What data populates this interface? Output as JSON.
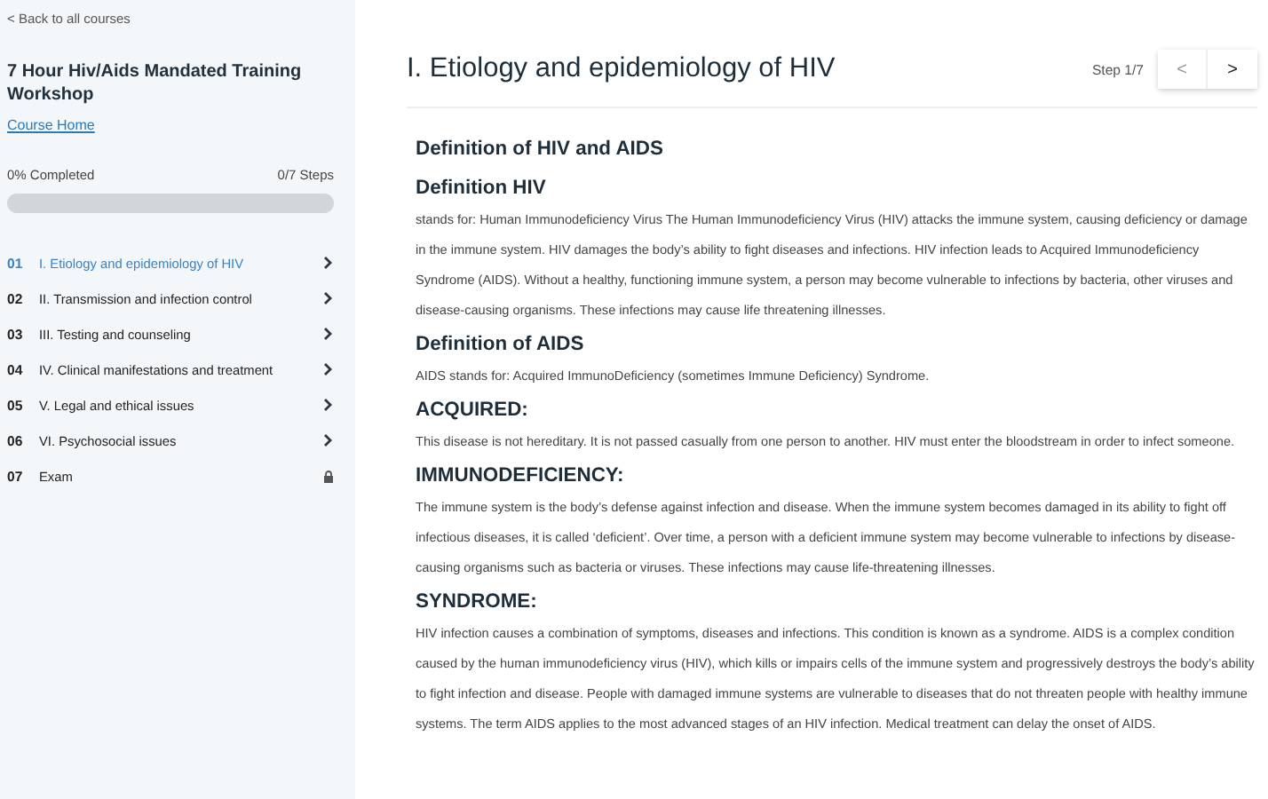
{
  "sidebar": {
    "back_link": "< Back to all courses",
    "course_title": "7 Hour Hiv/Aids Mandated Training Workshop",
    "course_home": "Course Home",
    "progress": {
      "completed": "0% Completed",
      "steps": "0/7 Steps",
      "level": 0
    },
    "lessons": [
      {
        "number": "01",
        "label": "I. Etiology and epidemiology of HIV",
        "selected": true,
        "kind": "open"
      },
      {
        "number": "02",
        "label": "II. Transmission and infection control",
        "selected": false,
        "kind": "open"
      },
      {
        "number": "03",
        "label": "III. Testing and counseling",
        "selected": false,
        "kind": "open"
      },
      {
        "number": "04",
        "label": "IV. Clinical manifestations and treatment",
        "selected": false,
        "kind": "open"
      },
      {
        "number": "05",
        "label": "V. Legal and ethical issues",
        "selected": false,
        "kind": "open"
      },
      {
        "number": "06",
        "label": "VI. Psychosocial issues",
        "selected": false,
        "kind": "open"
      },
      {
        "number": "07",
        "label": "Exam",
        "selected": false,
        "kind": "locked"
      }
    ]
  },
  "header": {
    "title": "I. Etiology and epidemiology of HIV",
    "step": "Step 1/7",
    "prev": "<",
    "next": ">"
  },
  "content": [
    {
      "kind": "section_title",
      "text": "Definition of HIV and AIDS"
    },
    {
      "kind": "heading",
      "text": "Definition HIV"
    },
    {
      "kind": "paragraph",
      "text": " stands for: Human Immunodeficiency Virus The Human Immunodeficiency Virus (HIV) attacks the immune system, causing deficiency or damage in the immune system. HIV damages the body’s ability to fight diseases and infections. HIV infection leads to Acquired Immunodeficiency Syndrome (AIDS). Without a healthy, functioning immune system, a person may become vulnerable to infections by bacteria, other viruses and disease-causing organisms. These infections may cause life threatening illnesses."
    },
    {
      "kind": "heading",
      "text": "Definition of AIDS"
    },
    {
      "kind": "paragraph",
      "text": "AIDS stands for: Acquired ImmunoDeficiency (sometimes Immune Deficiency) Syndrome."
    },
    {
      "kind": "heading",
      "text": "ACQUIRED:"
    },
    {
      "kind": "paragraph",
      "text": "This disease is not hereditary. It is not passed casually from one person to another. HIV must enter the bloodstream in order to infect someone."
    },
    {
      "kind": "heading",
      "text": "IMMUNODEFICIENCY:"
    },
    {
      "kind": "paragraph",
      "text": "The immune system is the body’s defense against infection and disease. When the immune system becomes damaged in its ability to fight off infectious diseases, it is called ‘deficient’. Over time, a person with a deficient immune system may become vulnerable to infections by disease-causing organisms such as bacteria or viruses. These infections may cause life-threatening illnesses."
    },
    {
      "kind": "heading",
      "text": "SYNDROME:"
    },
    {
      "kind": "paragraph",
      "text": "HIV infection causes a combination of symptoms, diseases and infections. This condition is known as a syndrome. AIDS is a complex condition caused by the human immunodeficiency virus (HIV), which kills or impairs cells of the immune system and progressively destroys the body’s ability to fight infection and disease. People with damaged immune systems are vulnerable to diseases that do not threaten people with healthy immune systems. The term AIDS applies to the most advanced stages of an HIV infection. Medical treatment can delay the onset of AIDS."
    }
  ]
}
